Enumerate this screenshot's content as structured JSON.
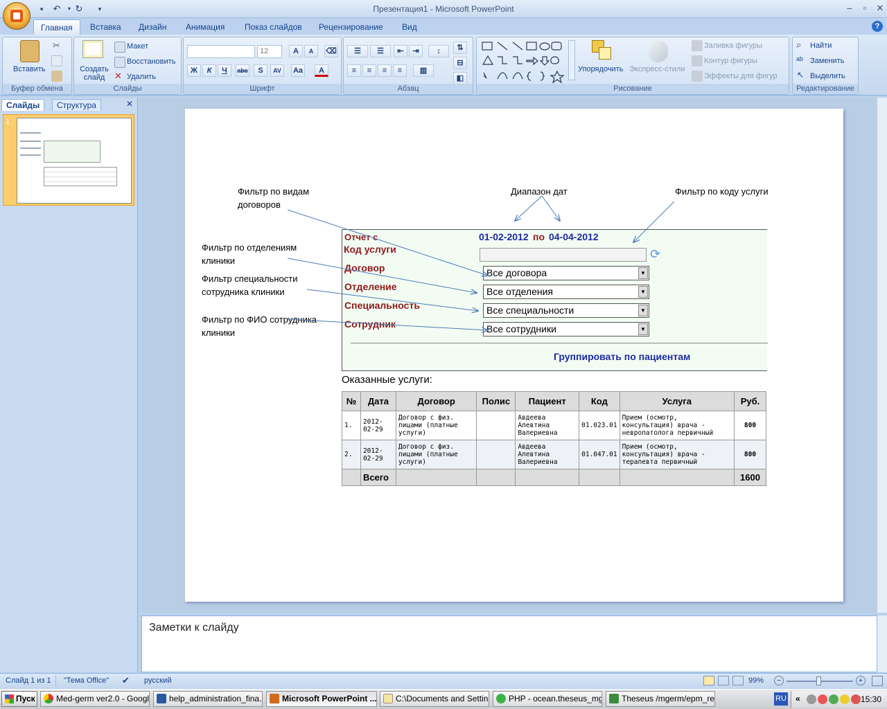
{
  "window": {
    "title": "Презентация1 - Microsoft PowerPoint"
  },
  "ribbon": {
    "tabs": [
      "Главная",
      "Вставка",
      "Дизайн",
      "Анимация",
      "Показ слайдов",
      "Рецензирование",
      "Вид"
    ],
    "clipboard": {
      "paste": "Вставить",
      "group": "Буфер обмена"
    },
    "slides": {
      "new_slide": "Создать слайд",
      "layout": "Макет",
      "reset": "Восстановить",
      "delete": "Удалить",
      "group": "Слайды"
    },
    "font": {
      "size": "12",
      "group": "Шрифт"
    },
    "paragraph": {
      "group": "Абзац"
    },
    "drawing": {
      "arrange": "Упорядочить",
      "styles": "Экспресс-стили",
      "fill": "Заливка фигуры",
      "outline": "Контур фигуры",
      "effects": "Эффекты для фигур",
      "group": "Рисование"
    },
    "editing": {
      "find": "Найти",
      "replace": "Заменить",
      "select": "Выделить",
      "group": "Редактирование"
    }
  },
  "left_panel": {
    "tab_slides": "Слайды",
    "tab_outline": "Структура",
    "slide_number": "1"
  },
  "slide": {
    "callouts": {
      "contract_filter": "Фильтр по видам договоров",
      "date_range": "Диапазон дат",
      "service_code_filter": "Фильтр по коду услуги",
      "department_filter": "Фильтр по отделениям клиники",
      "specialty_filter": "Фильтр специальности сотрудника клиники",
      "employee_filter": "Фильтр по ФИО сотрудника клиники"
    },
    "form": {
      "report_from": "Отчет с",
      "date_from": "01-02-2012",
      "date_to_label": "по",
      "date_to": "04-04-2012",
      "service_code": "Код услуги",
      "contract": "Договор",
      "department": "Отделение",
      "specialty": "Специальность",
      "employee": "Сотрудник",
      "contract_value": "Все договора",
      "department_value": "Все отделения",
      "specialty_value": "Все специальности",
      "employee_value": "Все сотрудники",
      "group_link": "Группировать по пациентам"
    },
    "services_title": "Оказанные услуги:",
    "table": {
      "headers": [
        "№",
        "Дата",
        "Договор",
        "Полис",
        "Пациент",
        "Код",
        "Услуга",
        "Руб."
      ],
      "rows": [
        [
          "1.",
          "2012-02-29",
          "Договор с физ. лицами (платные услуги)",
          "",
          "Авдеева Алевтина Валериевна",
          "01.023.01",
          "Прием (осмотр, консультация) врача - невропатолога первичный",
          "800"
        ],
        [
          "2.",
          "2012-02-29",
          "Договор с физ. лицами (платные услуги)",
          "",
          "Авдеева Алевтина Валериевна",
          "01.047.01",
          "Прием (осмотр, консультация) врача - терапевта первичный",
          "800"
        ]
      ],
      "total_label": "Всего",
      "total_value": "1600"
    }
  },
  "notes": {
    "placeholder": "Заметки к слайду"
  },
  "status": {
    "slide": "Слайд 1 из 1",
    "theme": "\"Тема Office\"",
    "language": "русский",
    "zoom": "99%"
  },
  "taskbar": {
    "start": "Пуск",
    "items": [
      "Med-germ ver2.0 - Googl...",
      "help_administration_fina...",
      "Microsoft PowerPoint ...",
      "C:\\Documents and Settin...",
      "PHP - ocean.theseus_mg...",
      "Theseus /mgerm/epm_re..."
    ],
    "lang": "RU",
    "time": "15:30"
  }
}
